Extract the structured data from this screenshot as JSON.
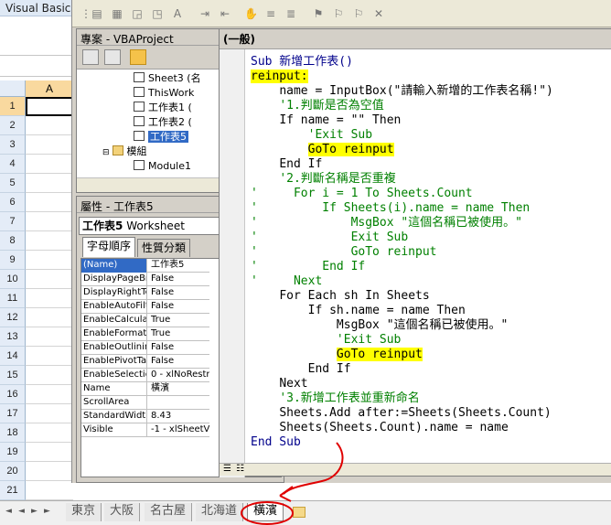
{
  "excel": {
    "title_fragment": "Visual Basic",
    "column_header": "A",
    "row_numbers": [
      "1",
      "2",
      "3",
      "4",
      "5",
      "6",
      "7",
      "8",
      "9",
      "10",
      "11",
      "12",
      "13",
      "14",
      "15",
      "16",
      "17",
      "18",
      "19",
      "20",
      "21"
    ],
    "sheet_tabs": [
      "東京",
      "大阪",
      "名古屋",
      "北海道",
      "橫濱"
    ],
    "active_tab_index": 4
  },
  "project_explorer": {
    "title": "專案 - VBAProject",
    "items": [
      {
        "label": "Sheet3 (名"
      },
      {
        "label": "ThisWork"
      },
      {
        "label": "工作表1 ("
      },
      {
        "label": "工作表2 ("
      },
      {
        "label": "工作表5"
      },
      {
        "label": "模組"
      },
      {
        "label": "Module1"
      }
    ]
  },
  "properties": {
    "title": "屬性 - 工作表5",
    "object_name": "工作表5",
    "object_type": "Worksheet",
    "tabs": [
      "字母順序",
      "性質分類"
    ],
    "rows": [
      {
        "name": "(Name)",
        "value": "工作表5"
      },
      {
        "name": "DisplayPageBr",
        "value": "False"
      },
      {
        "name": "DisplayRightTc",
        "value": "False"
      },
      {
        "name": "EnableAutoFilt",
        "value": "False"
      },
      {
        "name": "EnableCalculat",
        "value": "True"
      },
      {
        "name": "EnableFormatC",
        "value": "True"
      },
      {
        "name": "EnableOutlinin",
        "value": "False"
      },
      {
        "name": "EnablePivotTa",
        "value": "False"
      },
      {
        "name": "EnableSelectio",
        "value": "0 - xlNoRestr"
      },
      {
        "name": "Name",
        "value": "橫濱"
      },
      {
        "name": "ScrollArea",
        "value": ""
      },
      {
        "name": "StandardWidth",
        "value": "8.43"
      },
      {
        "name": "Visible",
        "value": "-1 - xlSheetV"
      }
    ]
  },
  "code_window": {
    "procedure": "(一般)",
    "lines": [
      {
        "indent": "",
        "text": "Sub 新增工作表()",
        "type": "kw",
        "highlight": false
      },
      {
        "indent": "",
        "text": "reinput:",
        "type": "normal",
        "highlight": true
      },
      {
        "indent": "    ",
        "text": "name = InputBox(\"請輸入新增的工作表名稱!\")",
        "type": "normal",
        "highlight": false
      },
      {
        "indent": "    ",
        "text": "'1.判斷是否為空值",
        "type": "comment",
        "highlight": false
      },
      {
        "indent": "    ",
        "text": "If name = \"\" Then",
        "type": "normal",
        "highlight": false
      },
      {
        "indent": "        ",
        "text": "'Exit Sub",
        "type": "comment",
        "highlight": false
      },
      {
        "indent": "        ",
        "text": "GoTo reinput",
        "type": "normal",
        "highlight": true
      },
      {
        "indent": "    ",
        "text": "End If",
        "type": "normal",
        "highlight": false
      },
      {
        "indent": "    ",
        "text": "'2.判斷名稱是否重複",
        "type": "comment",
        "highlight": false
      },
      {
        "indent": "",
        "text": "'     For i = 1 To Sheets.Count",
        "type": "comment",
        "highlight": false
      },
      {
        "indent": "",
        "text": "'         If Sheets(i).name = name Then",
        "type": "comment",
        "highlight": false
      },
      {
        "indent": "",
        "text": "'             MsgBox \"這個名稱已被使用。\"",
        "type": "comment",
        "highlight": false
      },
      {
        "indent": "",
        "text": "'             Exit Sub",
        "type": "comment",
        "highlight": false
      },
      {
        "indent": "",
        "text": "'             GoTo reinput",
        "type": "comment",
        "highlight": false
      },
      {
        "indent": "",
        "text": "'         End If",
        "type": "comment",
        "highlight": false
      },
      {
        "indent": "",
        "text": "'     Next",
        "type": "comment",
        "highlight": false
      },
      {
        "indent": "    ",
        "text": "For Each sh In Sheets",
        "type": "normal",
        "highlight": false
      },
      {
        "indent": "        ",
        "text": "If sh.name = name Then",
        "type": "normal",
        "highlight": false
      },
      {
        "indent": "            ",
        "text": "MsgBox \"這個名稱已被使用。\"",
        "type": "normal",
        "highlight": false
      },
      {
        "indent": "            ",
        "text": "'Exit Sub",
        "type": "comment",
        "highlight": false
      },
      {
        "indent": "            ",
        "text": "GoTo reinput",
        "type": "normal",
        "highlight": true
      },
      {
        "indent": "        ",
        "text": "End If",
        "type": "normal",
        "highlight": false
      },
      {
        "indent": "    ",
        "text": "Next",
        "type": "normal",
        "highlight": false
      },
      {
        "indent": "    ",
        "text": "'3.新增工作表並重新命名",
        "type": "comment",
        "highlight": false
      },
      {
        "indent": "    ",
        "text": "Sheets.Add after:=Sheets(Sheets.Count)",
        "type": "normal",
        "highlight": false
      },
      {
        "indent": "    ",
        "text": "Sheets(Sheets.Count).name = name",
        "type": "normal",
        "highlight": false
      },
      {
        "indent": "",
        "text": "End Sub",
        "type": "kw",
        "highlight": false
      }
    ]
  },
  "colors": {
    "highlight": "#ffff00",
    "comment": "#008000",
    "selection": "#316ac5",
    "annotation": "#e00000"
  }
}
